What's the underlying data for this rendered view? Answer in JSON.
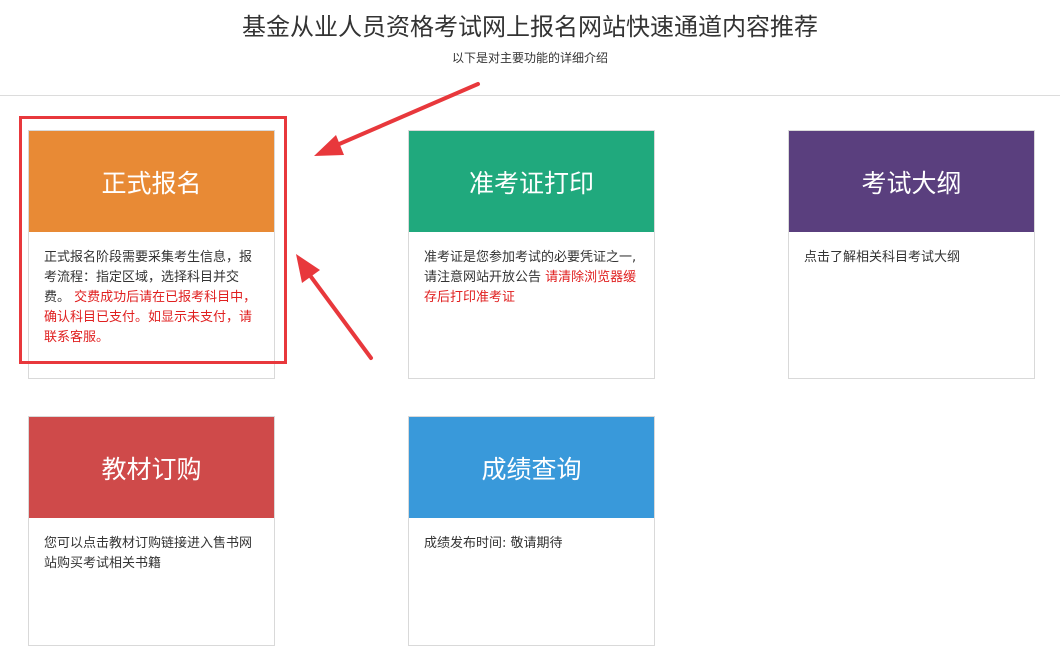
{
  "header": {
    "title": "基金从业人员资格考试网上报名网站快速通道内容推荐",
    "subtitle": "以下是对主要功能的详细介绍"
  },
  "cards": [
    {
      "title": "正式报名",
      "color": "#e88a35",
      "body": "正式报名阶段需要采集考生信息，报考流程：指定区域，选择科目并交费。",
      "warning": "交费成功后请在已报考科目中，确认科目已支付。如显示未支付，请联系客服。"
    },
    {
      "title": "准考证打印",
      "color": "#20a97d",
      "body": "准考证是您参加考试的必要凭证之一,请注意网站开放公告",
      "warning": "请清除浏览器缓存后打印准考证"
    },
    {
      "title": "考试大纲",
      "color": "#5a3f7e",
      "body": "点击了解相关科目考试大纲",
      "warning": ""
    },
    {
      "title": "教材订购",
      "color": "#cf4a4a",
      "body": "您可以点击教材订购链接进入售书网站购买考试相关书籍",
      "warning": ""
    },
    {
      "title": "成绩查询",
      "color": "#3999da",
      "body": "成绩发布时间: 敬请期待",
      "warning": ""
    }
  ],
  "annotation": {
    "color": "#e8383c"
  }
}
